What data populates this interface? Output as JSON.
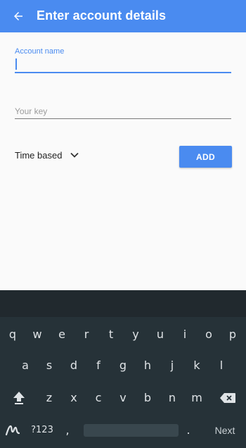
{
  "appbar": {
    "title": "Enter account details",
    "back_icon": "arrow-back-icon"
  },
  "form": {
    "account_name_label": "Account name",
    "account_name_value": "",
    "key_placeholder": "Your key",
    "key_value": "",
    "type_selected": "Time based",
    "add_label": "ADD"
  },
  "colors": {
    "accent": "#4a8bf0",
    "background": "#fafafa",
    "keyboard_bg": "#263238"
  },
  "keyboard": {
    "row1": [
      "q",
      "w",
      "e",
      "r",
      "t",
      "y",
      "u",
      "i",
      "o",
      "p"
    ],
    "row2": [
      "a",
      "s",
      "d",
      "f",
      "g",
      "h",
      "j",
      "k",
      "l"
    ],
    "row3": [
      "z",
      "x",
      "c",
      "v",
      "b",
      "n",
      "m"
    ],
    "symbols_label": "?123",
    "comma": ",",
    "period": ".",
    "next_label": "Next",
    "icons": {
      "shift": "shift-icon",
      "backspace": "backspace-icon",
      "emoji": "handwriting-icon"
    }
  }
}
